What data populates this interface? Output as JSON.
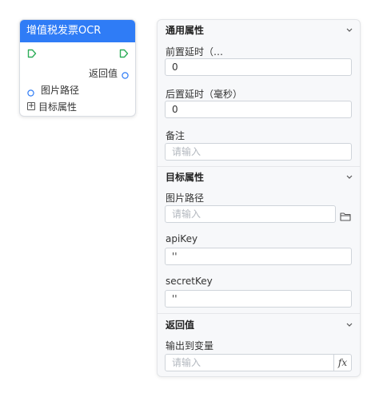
{
  "node": {
    "title": "增值税发票OCR",
    "return_value_label": "返回值",
    "image_path_label": "图片路径",
    "target_props_label": "目标属性",
    "expand_symbol": "+"
  },
  "panel": {
    "general": {
      "title": "通用属性",
      "pre_delay_label": "前置延时（…",
      "pre_delay_value": "0",
      "post_delay_label": "后置延时（毫秒）",
      "post_delay_value": "0",
      "note_label": "备注",
      "note_placeholder": "请输入"
    },
    "target": {
      "title": "目标属性",
      "image_path_label": "图片路径",
      "image_path_placeholder": "请输入",
      "apikey_label": "apiKey",
      "apikey_value": "''",
      "secretkey_label": "secretKey",
      "secretkey_value": "''"
    },
    "return": {
      "title": "返回值",
      "output_var_label": "输出到变量",
      "output_var_placeholder": "请输入",
      "fx_label": "fx"
    }
  },
  "colors": {
    "header_blue": "#2f7cf6",
    "flow_green": "#2fae5a",
    "port_blue": "#2f7cf6"
  },
  "icons": [
    "flow-in-icon",
    "flow-out-icon",
    "port-icon",
    "chevron-down-icon",
    "folder-icon",
    "fx-icon"
  ]
}
